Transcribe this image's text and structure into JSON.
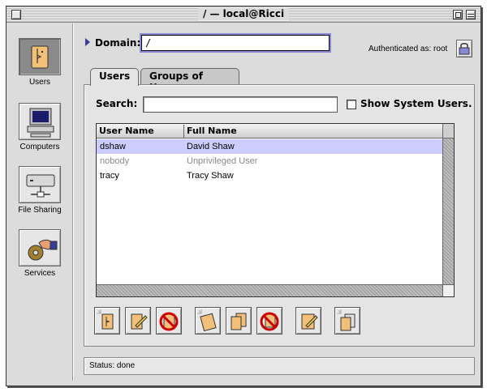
{
  "window": {
    "title": "/ — local@Ricci"
  },
  "sidebar": {
    "items": [
      {
        "label": "Users",
        "icon": "user-icon",
        "selected": true
      },
      {
        "label": "Computers",
        "icon": "computer-icon",
        "selected": false
      },
      {
        "label": "File Sharing",
        "icon": "file-sharing-icon",
        "selected": false
      },
      {
        "label": "Services",
        "icon": "services-icon",
        "selected": false
      }
    ]
  },
  "domain": {
    "label": "Domain:",
    "value": "/",
    "auth_text": "Authenticated as: root"
  },
  "tabs": [
    {
      "label": "Users",
      "active": true
    },
    {
      "label": "Groups of Users",
      "active": false
    }
  ],
  "users_panel": {
    "search_label": "Search:",
    "search_value": "",
    "show_system_label": "Show System Users.",
    "show_system_checked": false,
    "columns": [
      "User Name",
      "Full Name"
    ],
    "rows": [
      {
        "user": "dshaw",
        "full": "David Shaw",
        "selected": true,
        "dimmed": false
      },
      {
        "user": "nobody",
        "full": "Unprivileged User",
        "selected": false,
        "dimmed": true
      },
      {
        "user": "tracy",
        "full": "Tracy Shaw",
        "selected": false,
        "dimmed": false
      }
    ]
  },
  "toolbar": {
    "buttons": [
      "new-user-icon",
      "edit-user-icon",
      "delete-user-icon",
      "new-group-icon",
      "add-to-group-icon",
      "delete-group-icon",
      "edit-icon",
      "duplicate-icon"
    ]
  },
  "status": {
    "text": "Status: done"
  },
  "colors": {
    "selection": "#ccccff",
    "focus_ring": "#8a8ad8",
    "window_bg": "#dcdcdc"
  }
}
